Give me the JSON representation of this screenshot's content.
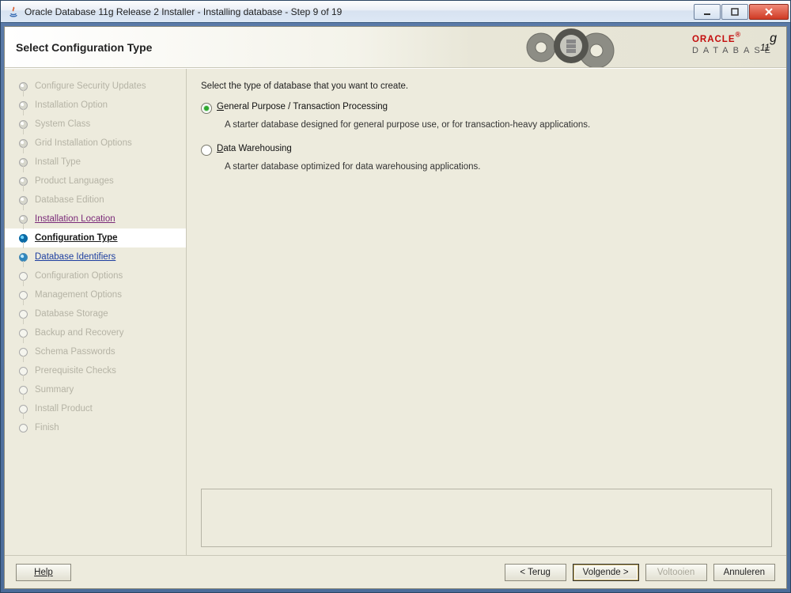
{
  "window": {
    "title": "Oracle Database 11g Release 2 Installer - Installing database - Step 9 of 19"
  },
  "header": {
    "title": "Select Configuration Type",
    "brand_line1": "ORACLE",
    "brand_line2": "DATABASE",
    "brand_ver": "11",
    "brand_ver_sup": "g"
  },
  "sidebar": {
    "items": [
      {
        "label": "Configure Security Updates",
        "state": "done"
      },
      {
        "label": "Installation Option",
        "state": "done"
      },
      {
        "label": "System Class",
        "state": "done"
      },
      {
        "label": "Grid Installation Options",
        "state": "done"
      },
      {
        "label": "Install Type",
        "state": "done"
      },
      {
        "label": "Product Languages",
        "state": "done"
      },
      {
        "label": "Database Edition",
        "state": "done"
      },
      {
        "label": "Installation Location",
        "state": "visitedlink"
      },
      {
        "label": "Configuration Type",
        "state": "current"
      },
      {
        "label": "Database Identifiers",
        "state": "nextlink"
      },
      {
        "label": "Configuration Options",
        "state": "future"
      },
      {
        "label": "Management Options",
        "state": "future"
      },
      {
        "label": "Database Storage",
        "state": "future"
      },
      {
        "label": "Backup and Recovery",
        "state": "future"
      },
      {
        "label": "Schema Passwords",
        "state": "future"
      },
      {
        "label": "Prerequisite Checks",
        "state": "future"
      },
      {
        "label": "Summary",
        "state": "future"
      },
      {
        "label": "Install Product",
        "state": "future"
      },
      {
        "label": "Finish",
        "state": "future"
      }
    ]
  },
  "content": {
    "lead": "Select the type of database that you want to create.",
    "options": [
      {
        "mnemonic": "G",
        "label_rest": "eneral Purpose / Transaction Processing",
        "desc": "A starter database designed for general purpose use, or for transaction-heavy applications.",
        "selected": true
      },
      {
        "mnemonic": "D",
        "label_rest": "ata Warehousing",
        "desc": "A starter database optimized for data warehousing applications.",
        "selected": false
      }
    ]
  },
  "footer": {
    "help": "Help",
    "back": "< Terug",
    "next": "Volgende >",
    "finish": "Voltooien",
    "cancel": "Annuleren"
  }
}
